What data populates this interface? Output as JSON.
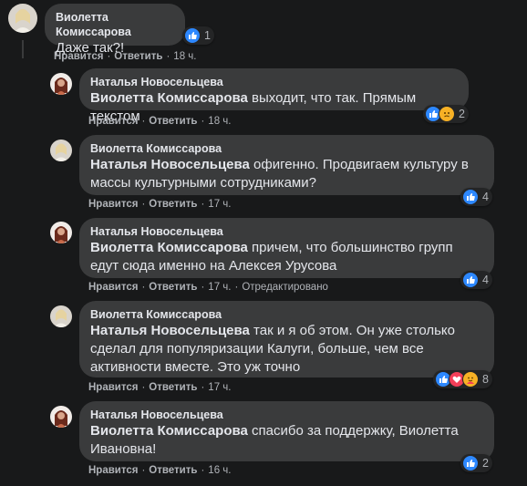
{
  "actions": {
    "like": "Нравится",
    "reply": "Ответить"
  },
  "comments": [
    {
      "author": "Виолетта Комиссарова",
      "mention": "",
      "text": "Даже так?!",
      "time": "18 ч.",
      "edited": "",
      "reactions": [
        "like"
      ],
      "count": "1"
    },
    {
      "author": "Наталья Новосельцева",
      "mention": "Виолетта Комиссарова",
      "text": " выходит, что так. Прямым текстом",
      "time": "18 ч.",
      "edited": "",
      "reactions": [
        "like",
        "sad"
      ],
      "count": "2"
    },
    {
      "author": "Виолетта Комиссарова",
      "mention": "Наталья Новосельцева",
      "text": " офигенно. Продвигаем культуру в массы культурными сотрудниками?",
      "time": "17 ч.",
      "edited": "",
      "reactions": [
        "like"
      ],
      "count": "4"
    },
    {
      "author": "Наталья Новосельцева",
      "mention": "Виолетта Комиссарова",
      "text": " причем, что большинство групп едут сюда именно на Алексея Урусова",
      "time": "17 ч.",
      "edited": "Отредактировано",
      "reactions": [
        "like"
      ],
      "count": "4"
    },
    {
      "author": "Виолетта Комиссарова",
      "mention": "Наталья Новосельцева",
      "text": " так и я об этом. Он уже столько сделал для популяризации Калуги, больше, чем все активности вместе. Это уж точно",
      "time": "17 ч.",
      "edited": "",
      "reactions": [
        "like",
        "love",
        "care"
      ],
      "count": "8"
    },
    {
      "author": "Наталья Новосельцева",
      "mention": "Виолетта Комиссарова",
      "text": " спасибо за поддержку, Виолетта Ивановна!",
      "time": "16 ч.",
      "edited": "",
      "reactions": [
        "like"
      ],
      "count": "2"
    }
  ]
}
